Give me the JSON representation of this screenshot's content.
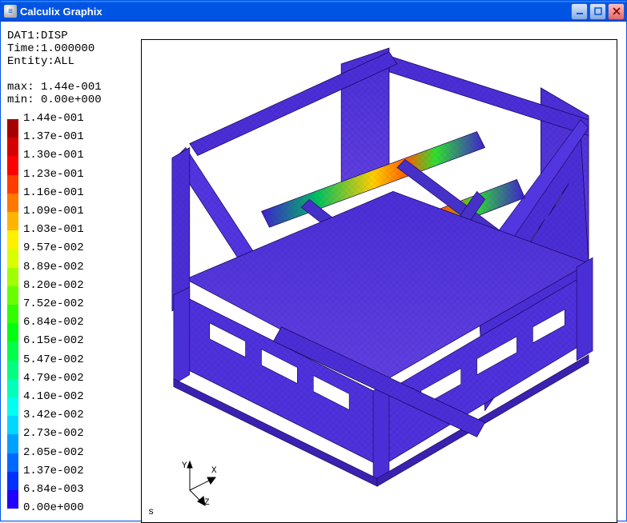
{
  "window": {
    "title": "Calculix Graphix",
    "app_icon_glyph": "≡"
  },
  "info": {
    "dataset": "DAT1:DISP",
    "time_label": "Time:1.000000",
    "entity": "Entity:ALL",
    "max": "max: 1.44e-001",
    "min": "min: 0.00e+000"
  },
  "legend": {
    "labels": [
      "1.44e-001",
      "1.37e-001",
      "1.30e-001",
      "1.23e-001",
      "1.16e-001",
      "1.09e-001",
      "1.03e-001",
      "9.57e-002",
      "8.89e-002",
      "8.20e-002",
      "7.52e-002",
      "6.84e-002",
      "6.15e-002",
      "5.47e-002",
      "4.79e-002",
      "4.10e-002",
      "3.42e-002",
      "2.73e-002",
      "2.05e-002",
      "1.37e-002",
      "6.84e-003",
      "0.00e+000"
    ],
    "colors": [
      "#a60000",
      "#d60000",
      "#ff0000",
      "#ff3c00",
      "#ff7800",
      "#ffb400",
      "#fff000",
      "#d8ff00",
      "#a0ff00",
      "#68ff00",
      "#30ff00",
      "#00ff10",
      "#00ff48",
      "#00ff80",
      "#00ffb8",
      "#00fff0",
      "#00d8ff",
      "#00a0ff",
      "#0068ff",
      "#0030ff",
      "#2000ff"
    ]
  },
  "axis": {
    "y": "Y",
    "x": "X",
    "z": "Z"
  },
  "corner_label": "s"
}
